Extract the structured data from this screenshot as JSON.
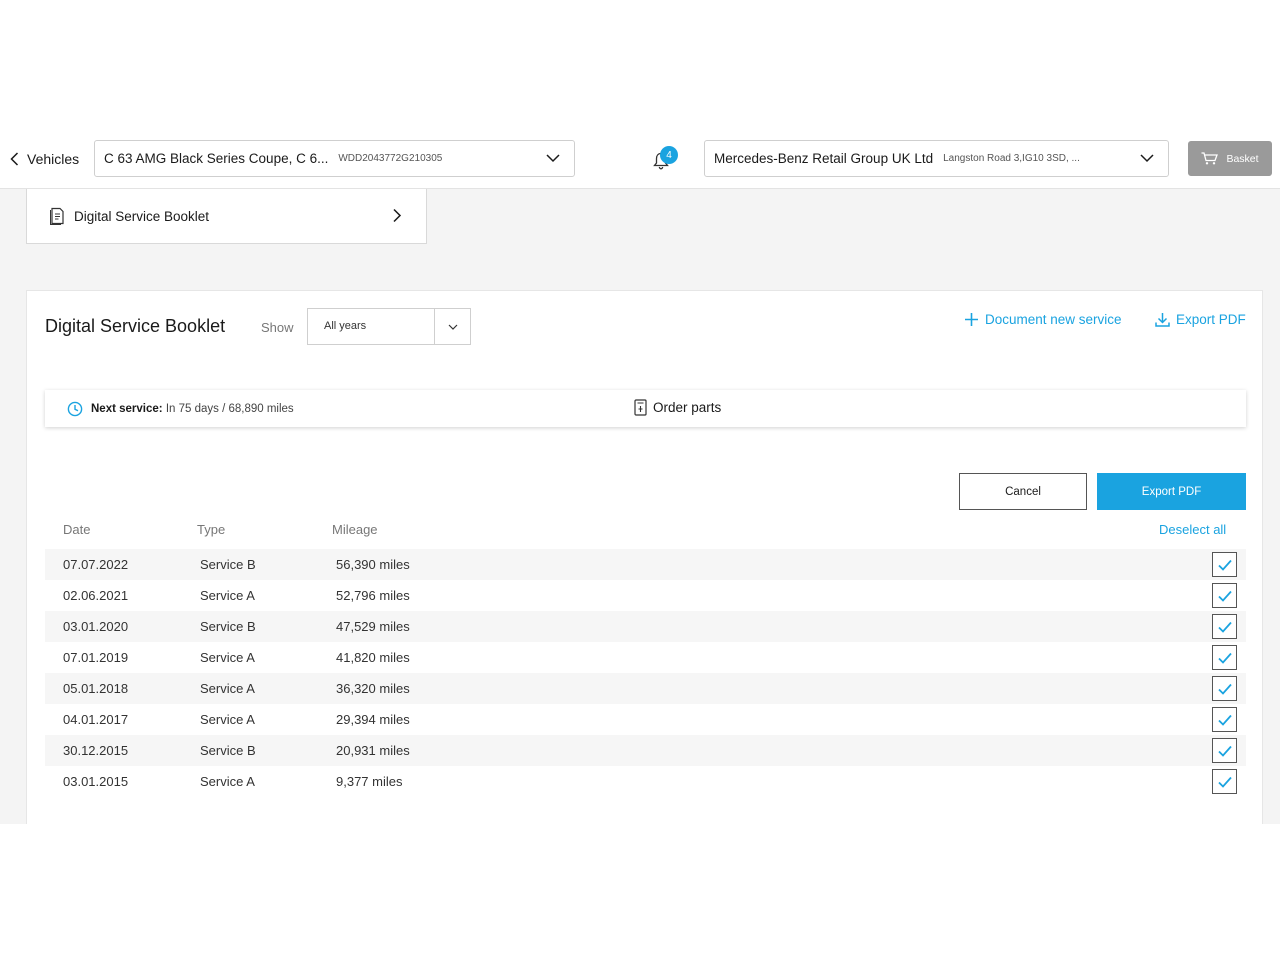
{
  "header": {
    "back_label": "Vehicles",
    "vehicle_name": "C 63 AMG Black Series Coupe, C 6...",
    "vehicle_vin": "WDD2043772G210305",
    "notification_count": "4",
    "dealer_name": "Mercedes-Benz Retail Group UK Ltd",
    "dealer_address": "Langston Road 3,IG10 3SD, ...",
    "basket_label": "Basket"
  },
  "side_nav": {
    "label": "Digital Service Booklet"
  },
  "booklet": {
    "title": "Digital Service Booklet",
    "show_label": "Show",
    "year_filter": "All years",
    "document_new_label": "Document new service",
    "export_link_label": "Export PDF",
    "next_service_label": "Next service:",
    "next_service_value": "In 75 days / 68,890 miles",
    "order_parts_label": "Order parts",
    "cancel_label": "Cancel",
    "export_button_label": "Export PDF",
    "columns": {
      "date": "Date",
      "type": "Type",
      "mileage": "Mileage"
    },
    "deselect_label": "Deselect all",
    "rows": [
      {
        "date": "07.07.2022",
        "type": "Service B",
        "mileage": "56,390 miles",
        "checked": true
      },
      {
        "date": "02.06.2021",
        "type": "Service A",
        "mileage": "52,796 miles",
        "checked": true
      },
      {
        "date": "03.01.2020",
        "type": "Service B",
        "mileage": "47,529 miles",
        "checked": true
      },
      {
        "date": "07.01.2019",
        "type": "Service A",
        "mileage": "41,820 miles",
        "checked": true
      },
      {
        "date": "05.01.2018",
        "type": "Service A",
        "mileage": "36,320 miles",
        "checked": true
      },
      {
        "date": "04.01.2017",
        "type": "Service A",
        "mileage": "29,394 miles",
        "checked": true
      },
      {
        "date": "30.12.2015",
        "type": "Service B",
        "mileage": "20,931 miles",
        "checked": true
      },
      {
        "date": "03.01.2015",
        "type": "Service A",
        "mileage": "9,377 miles",
        "checked": true
      }
    ]
  },
  "colors": {
    "accent": "#1aa3e0",
    "basket_bg": "#9a9a9a",
    "page_bg": "#f4f4f4"
  }
}
